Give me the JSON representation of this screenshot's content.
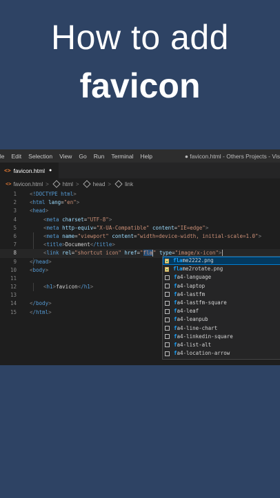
{
  "headline": {
    "line1": "How to add",
    "line2": "favicon"
  },
  "menubar": {
    "items": [
      "ile",
      "Edit",
      "Selection",
      "View",
      "Go",
      "Run",
      "Terminal",
      "Help"
    ],
    "window_title": "● favicon.html - Others Projects - Vis"
  },
  "tab": {
    "icon_text": "<>",
    "label": "favicon.html",
    "modified_indicator": "●"
  },
  "breadcrumb": {
    "file": "favicon.html",
    "items": [
      "html",
      "head",
      "link"
    ],
    "separator": ">"
  },
  "code": {
    "line_numbers": [
      "1",
      "2",
      "3",
      "4",
      "5",
      "6",
      "7",
      "8",
      "9",
      "10",
      "11",
      "12",
      "13",
      "14",
      "15"
    ],
    "lines": [
      "<!DOCTYPE html>",
      "<html lang=\"en\">",
      "<head>",
      "<meta charset=\"UTF-8\">",
      "<meta http-equiv=\"X-UA-Compatible\" content=\"IE=edge\">",
      "<meta name=\"viewport\" content=\"width=device-width, initial-scale=1.0\">",
      "<title>Document</title>",
      "<link rel=\"shortcut icon\" href=\"fla\" type=\"image/x-icon\">",
      "</head>",
      "<body>",
      "",
      "<h1>favicon</h1>",
      "",
      "</body>",
      "</html>"
    ],
    "active_line": 8,
    "typed_text": "fla"
  },
  "suggestions": [
    {
      "label": "flame2222.png",
      "kind": "image",
      "selected": true
    },
    {
      "label": "flame2rotate.png",
      "kind": "image",
      "selected": false
    },
    {
      "label": "fa4-language",
      "kind": "folder",
      "selected": false
    },
    {
      "label": "fa4-laptop",
      "kind": "folder",
      "selected": false
    },
    {
      "label": "fa4-lastfm",
      "kind": "folder",
      "selected": false
    },
    {
      "label": "fa4-lastfm-square",
      "kind": "folder",
      "selected": false
    },
    {
      "label": "fa4-leaf",
      "kind": "folder",
      "selected": false
    },
    {
      "label": "fa4-leanpub",
      "kind": "folder",
      "selected": false
    },
    {
      "label": "fa4-line-chart",
      "kind": "folder",
      "selected": false
    },
    {
      "label": "fa4-linkedin-square",
      "kind": "folder",
      "selected": false
    },
    {
      "label": "fa4-list-alt",
      "kind": "folder",
      "selected": false
    },
    {
      "label": "fa4-location-arrow",
      "kind": "folder",
      "selected": false
    }
  ],
  "colors": {
    "background": "#2e4364",
    "editor_background": "#1e1e1e",
    "tag": "#569cd6",
    "attribute": "#9cdcfe",
    "string": "#ce9178",
    "match_highlight": "#18a3ff",
    "file_icon": "#e37933"
  }
}
